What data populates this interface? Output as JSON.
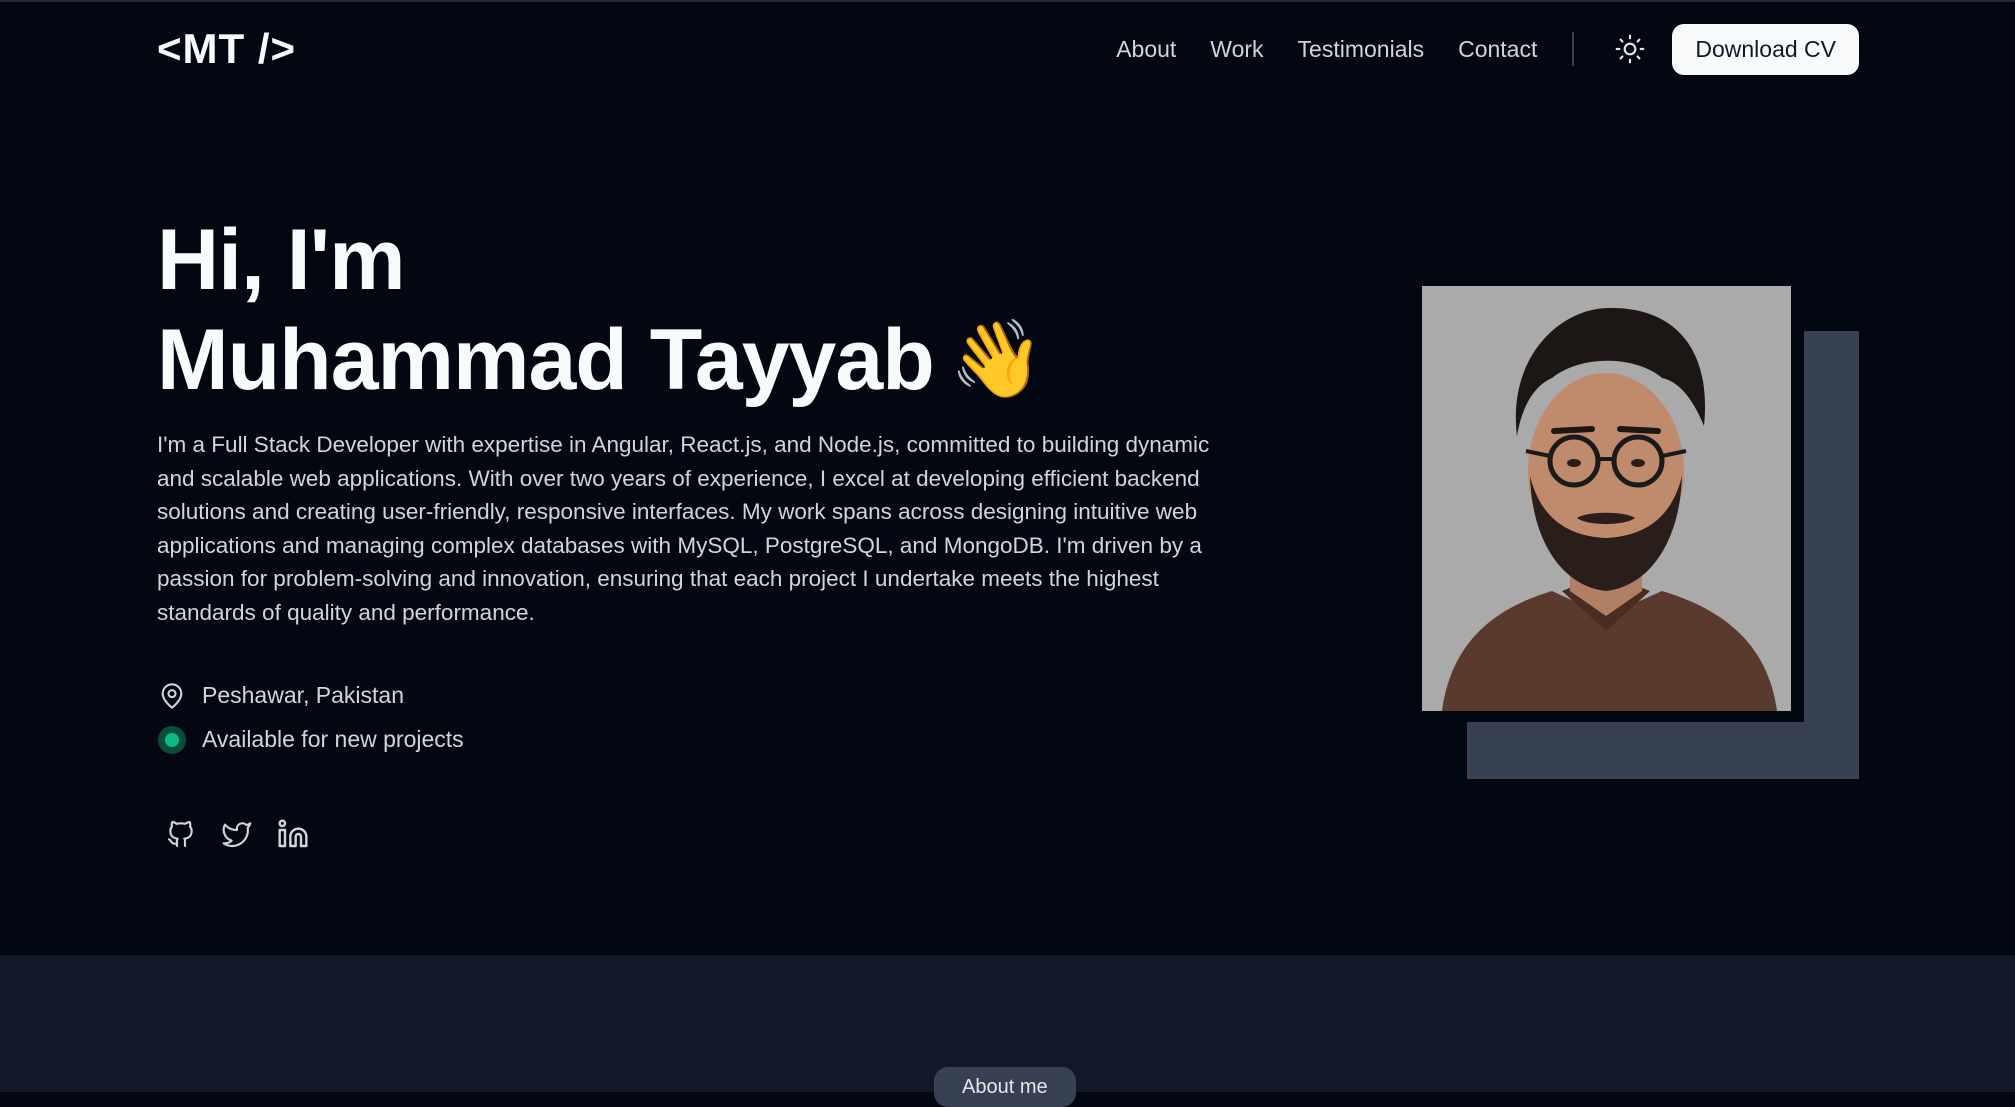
{
  "header": {
    "logo": "<MT />",
    "nav": [
      "About",
      "Work",
      "Testimonials",
      "Contact"
    ],
    "download_label": "Download CV"
  },
  "hero": {
    "greeting": "Hi, I'm",
    "name": "Muhammad Tayyab",
    "wave": "👋",
    "bio": "I'm a Full Stack Developer with expertise in Angular, React.js, and Node.js, committed to building dynamic and scalable web applications. With over two years of experience, I excel at developing efficient backend solutions and creating user-friendly, responsive interfaces. My work spans across designing intuitive web applications and managing complex databases with MySQL, PostgreSQL, and MongoDB. I'm driven by a passion for problem-solving and innovation, ensuring that each project I undertake meets the highest standards of quality and performance.",
    "location": "Peshawar, Pakistan",
    "availability": "Available for new projects"
  },
  "about": {
    "pill": "About me"
  },
  "colors": {
    "background": "#030712",
    "section_bg": "#111827",
    "accent_green": "#10b981"
  }
}
